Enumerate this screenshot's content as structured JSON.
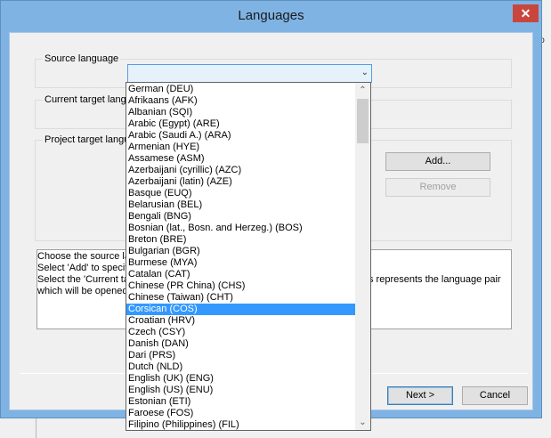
{
  "window": {
    "title": "Languages",
    "close_glyph": "✕"
  },
  "background_app": {
    "text1": "lo",
    "text2": "n",
    "text3": "h"
  },
  "groups": {
    "source_label": "Source language",
    "current_target_label": "Current target langu",
    "project_target_label": "Project target langu"
  },
  "buttons": {
    "add": "Add...",
    "remove": "Remove",
    "next": "Next >",
    "cancel": "Cancel"
  },
  "info": {
    "line1": "Choose the source la",
    "line2": "Select 'Add' to specif",
    "line3": "Select the 'Current ta",
    "line3_right": "s represents the language pair",
    "line4": "which will be opened"
  },
  "dropdown": {
    "selected_index": 19,
    "items": [
      "German (DEU)",
      "Afrikaans (AFK)",
      "Albanian (SQI)",
      "Arabic (Egypt) (ARE)",
      "Arabic (Saudi A.) (ARA)",
      "Armenian (HYE)",
      "Assamese (ASM)",
      "Azerbaijani (cyrillic) (AZC)",
      "Azerbaijani (latin) (AZE)",
      "Basque (EUQ)",
      "Belarusian (BEL)",
      "Bengali (BNG)",
      "Bosnian (lat., Bosn. and Herzeg.) (BOS)",
      "Breton (BRE)",
      "Bulgarian (BGR)",
      "Burmese (MYA)",
      "Catalan (CAT)",
      "Chinese (PR China) (CHS)",
      "Chinese (Taiwan) (CHT)",
      "Corsican (COS)",
      "Croatian (HRV)",
      "Czech (CSY)",
      "Danish (DAN)",
      "Dari (PRS)",
      "Dutch (NLD)",
      "English (UK) (ENG)",
      "English (US) (ENU)",
      "Estonian (ETI)",
      "Faroese (FOS)",
      "Filipino (Philippines) (FIL)"
    ]
  },
  "icons": {
    "combo_arrow": "chevron-down-icon",
    "scroll_up": "chevron-up-icon",
    "scroll_down": "chevron-down-icon",
    "close": "close-icon"
  }
}
